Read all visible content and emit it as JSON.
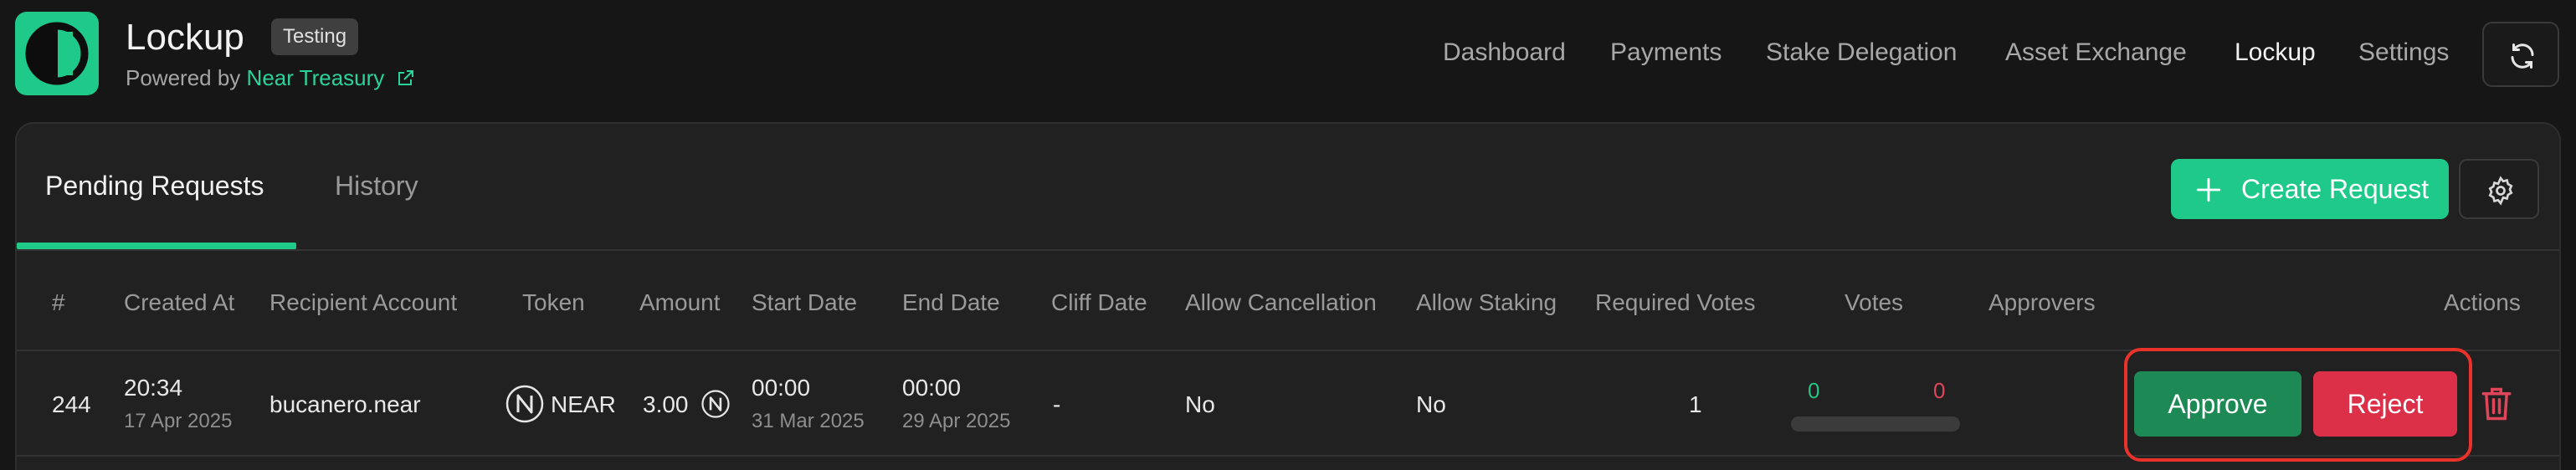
{
  "header": {
    "app_title": "Lockup",
    "env_badge": "Testing",
    "powered_prefix": "Powered by",
    "powered_link": "Near Treasury",
    "nav": [
      "Dashboard",
      "Payments",
      "Stake Delegation",
      "Asset Exchange",
      "Lockup",
      "Settings"
    ],
    "nav_active": "Lockup"
  },
  "tabs": {
    "pending": "Pending Requests",
    "history": "History",
    "active": "Pending Requests"
  },
  "toolbar": {
    "create_label": "Create Request"
  },
  "table": {
    "columns": [
      "#",
      "Created At",
      "Recipient Account",
      "Token",
      "Amount",
      "Start Date",
      "End Date",
      "Cliff Date",
      "Allow Cancellation",
      "Allow Staking",
      "Required Votes",
      "Votes",
      "Approvers",
      "Actions"
    ],
    "rows": [
      {
        "id": "244",
        "created_time": "20:34",
        "created_date": "17 Apr 2025",
        "recipient": "bucanero.near",
        "token": "NEAR",
        "amount": "3.00",
        "start_time": "00:00",
        "start_date": "31 Mar 2025",
        "end_time": "00:00",
        "end_date": "29 Apr 2025",
        "cliff_date": "-",
        "allow_cancellation": "No",
        "allow_staking": "No",
        "required_votes": "1",
        "votes_approve": "0",
        "votes_reject": "0",
        "approve_label": "Approve",
        "reject_label": "Reject"
      }
    ]
  },
  "colors": {
    "accent": "#1fc98a",
    "approve": "#1d8a55",
    "reject": "#dc3048",
    "highlight": "#e8322a"
  },
  "icons": [
    "app-logo-icon",
    "external-link-icon",
    "refresh-icon",
    "plus-icon",
    "gear-icon",
    "near-token-icon",
    "trash-icon"
  ]
}
